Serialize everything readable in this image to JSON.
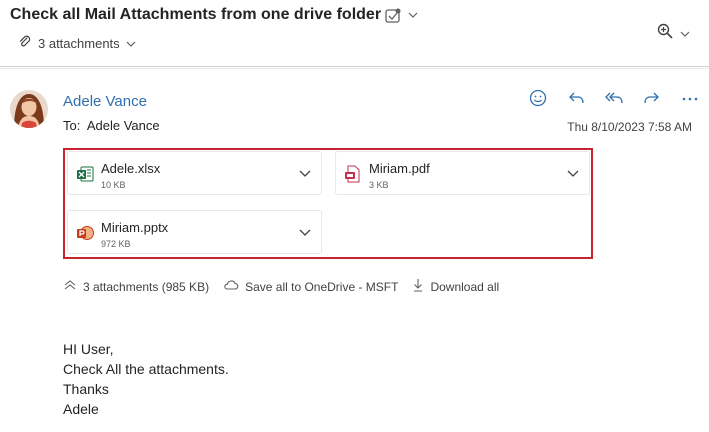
{
  "header": {
    "subject": "Check all Mail Attachments from one drive folder",
    "attachments_label": "3 attachments"
  },
  "message": {
    "sender": "Adele Vance",
    "to_label": "To:",
    "to_value": "Adele Vance",
    "date": "Thu 8/10/2023 7:58 AM"
  },
  "attachments": [
    {
      "name": "Adele.xlsx",
      "size": "10 KB",
      "icon": "excel-file-icon",
      "color": "#1d6f42"
    },
    {
      "name": "Miriam.pdf",
      "size": "3 KB",
      "icon": "pdf-file-icon",
      "color": "#c4314b"
    },
    {
      "name": "Miriam.pptx",
      "size": "972 KB",
      "icon": "powerpoint-file-icon",
      "color": "#c43e1c"
    }
  ],
  "footer": {
    "summary": "3 attachments (985 KB)",
    "save_all": "Save all to OneDrive - MSFT",
    "download_all": "Download all"
  },
  "body": {
    "line1": "HI User,",
    "line2": "Check All the attachments.",
    "line3": "Thanks",
    "line4": "Adele"
  },
  "colors": {
    "accent": "#2f6fb0",
    "highlight_border": "#c8242f"
  }
}
